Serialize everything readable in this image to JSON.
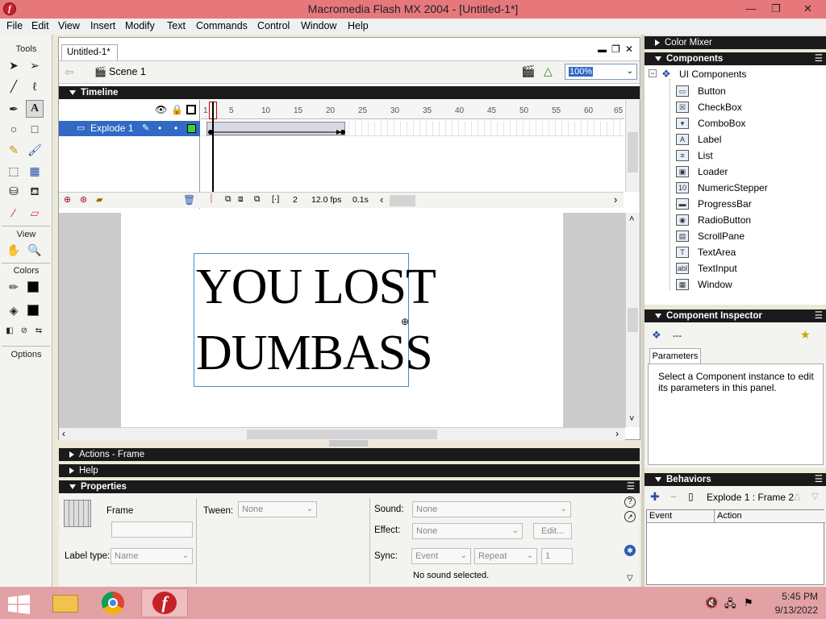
{
  "window": {
    "title": "Macromedia Flash MX 2004 - [Untitled-1*]",
    "app_icon": "flash-icon",
    "controls": [
      "minimize-icon",
      "restore-icon",
      "close-icon"
    ],
    "control_glyphs": [
      "—",
      "❐",
      "✕"
    ]
  },
  "menubar": {
    "items": [
      "File",
      "Edit",
      "View",
      "Insert",
      "Modify",
      "Text",
      "Commands",
      "Control",
      "Window",
      "Help"
    ]
  },
  "tools": {
    "title": "Tools",
    "view_label": "View",
    "colors_label": "Colors",
    "options_label": "Options"
  },
  "document": {
    "tab_label": "Untitled-1*",
    "scene_label": "Scene 1",
    "zoom_value": "100%"
  },
  "timeline": {
    "title": "Timeline",
    "ruler_ticks": [
      "1",
      "5",
      "10",
      "15",
      "20",
      "25",
      "30",
      "35",
      "40",
      "45",
      "50",
      "55",
      "60",
      "65"
    ],
    "layer_name": "Explode 1",
    "current_frame": "2",
    "frame_rate": "12.0 fps",
    "elapsed": "0.1s"
  },
  "stage": {
    "text_line1": "YOU LOST",
    "text_line2": "DUMBASS"
  },
  "collapsed_panels": {
    "actions": "Actions - Frame",
    "help": "Help"
  },
  "properties": {
    "title": "Properties",
    "frame_label": "Frame",
    "label_type_label": "Label type:",
    "label_type_value": "Name",
    "tween_label": "Tween:",
    "tween_value": "None",
    "sound_label": "Sound:",
    "sound_value": "None",
    "effect_label": "Effect:",
    "effect_value": "None",
    "edit_button": "Edit...",
    "sync_label": "Sync:",
    "sync_value": "Event",
    "repeat_value": "Repeat",
    "repeat_count": "1",
    "sound_status": "No sound selected."
  },
  "color_mixer": {
    "title": "Color Mixer"
  },
  "components": {
    "title": "Components",
    "group": "UI Components",
    "items": [
      {
        "label": "Button",
        "icon": "button-component-icon",
        "glyph": "▭"
      },
      {
        "label": "CheckBox",
        "icon": "checkbox-component-icon",
        "glyph": "☒"
      },
      {
        "label": "ComboBox",
        "icon": "combobox-component-icon",
        "glyph": "▾"
      },
      {
        "label": "Label",
        "icon": "label-component-icon",
        "glyph": "A"
      },
      {
        "label": "List",
        "icon": "list-component-icon",
        "glyph": "≡"
      },
      {
        "label": "Loader",
        "icon": "loader-component-icon",
        "glyph": "▣"
      },
      {
        "label": "NumericStepper",
        "icon": "numericstepper-component-icon",
        "glyph": "10"
      },
      {
        "label": "ProgressBar",
        "icon": "progressbar-component-icon",
        "glyph": "▬"
      },
      {
        "label": "RadioButton",
        "icon": "radiobutton-component-icon",
        "glyph": "◉"
      },
      {
        "label": "ScrollPane",
        "icon": "scrollpane-component-icon",
        "glyph": "▤"
      },
      {
        "label": "TextArea",
        "icon": "textarea-component-icon",
        "glyph": "T"
      },
      {
        "label": "TextInput",
        "icon": "textinput-component-icon",
        "glyph": "abl"
      },
      {
        "label": "Window",
        "icon": "window-component-icon",
        "glyph": "▦"
      }
    ]
  },
  "component_inspector": {
    "title": "Component Inspector",
    "instance_name": "---",
    "tab_label": "Parameters",
    "hint": "Select a Component instance to edit its parameters in this panel."
  },
  "behaviors": {
    "title": "Behaviors",
    "context": "Explode 1 : Frame 2",
    "col_event": "Event",
    "col_action": "Action"
  },
  "taskbar": {
    "time": "5:45 PM",
    "date": "9/13/2022"
  }
}
